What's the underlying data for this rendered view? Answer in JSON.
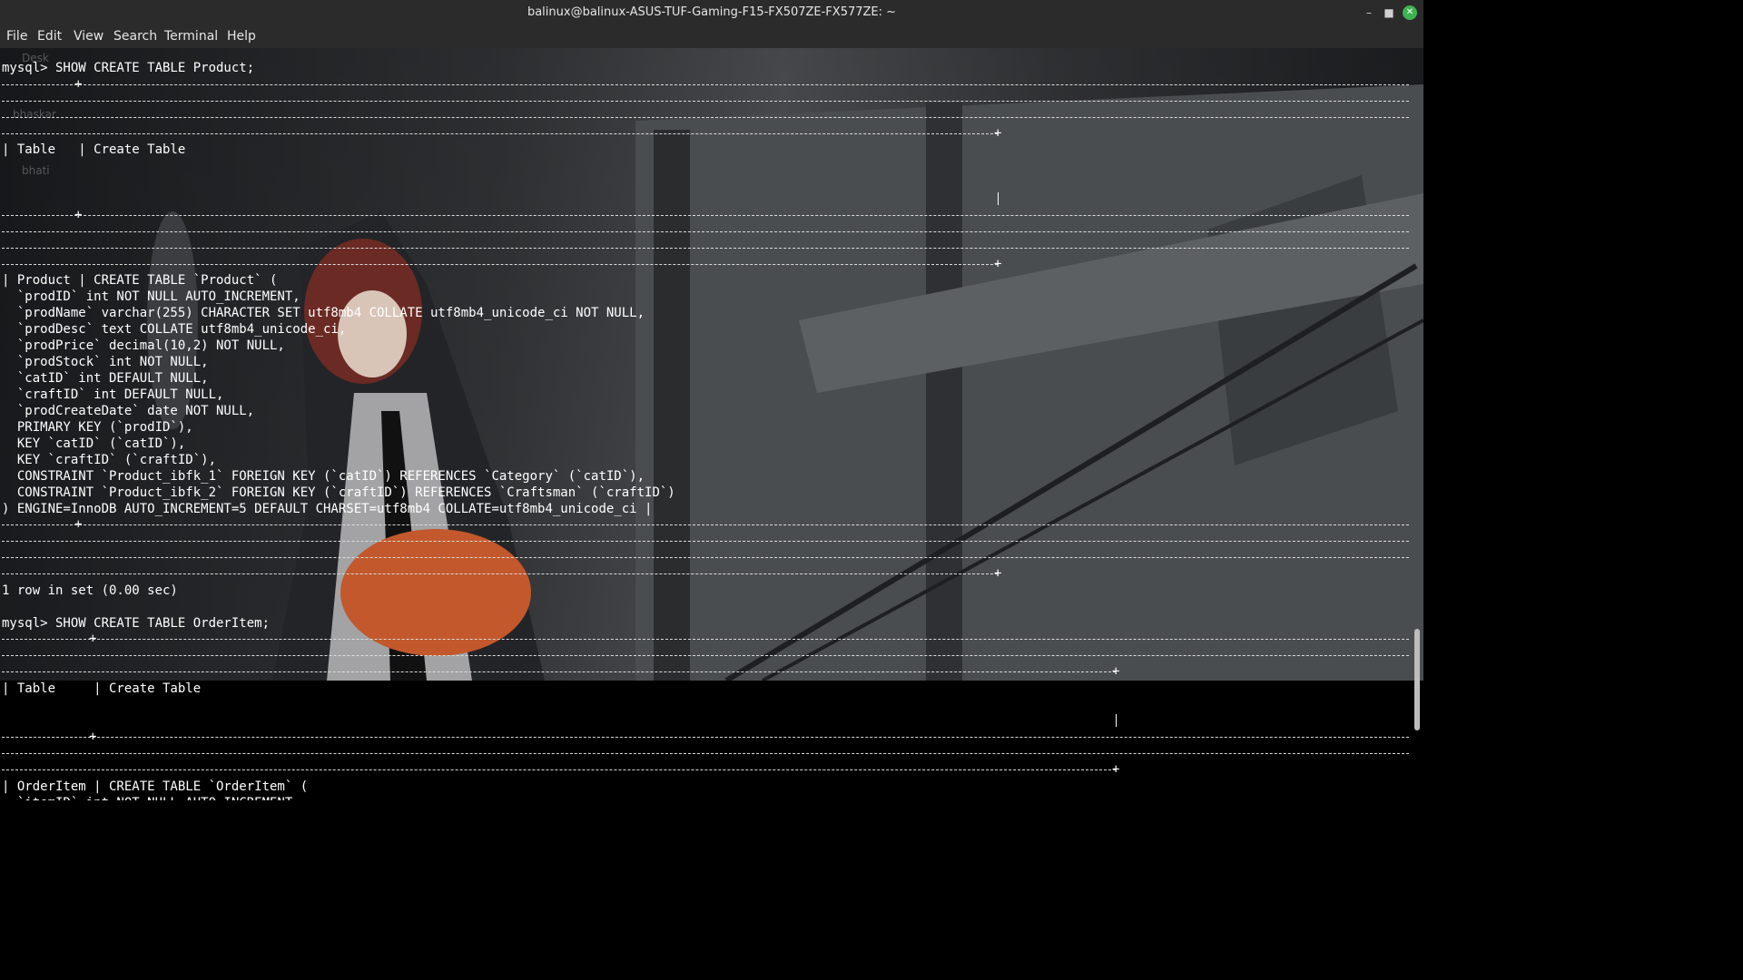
{
  "window": {
    "title": "balinux@balinux-ASUS-TUF-Gaming-F15-FX507ZE-FX577ZE: ~",
    "minimize_icon": "minimize-icon",
    "maximize_icon": "maximize-icon",
    "close_icon": "close-icon"
  },
  "menu": [
    "File",
    "Edit",
    "View",
    "Search",
    "Terminal",
    "Help"
  ],
  "desktop_labels": [
    "Desk",
    "bhaskar",
    "bhati"
  ],
  "terminal": {
    "lines": [
      "mysql> SHOW CREATE TABLE Product;",
      "",
      "",
      "",
      "",
      "| Table   | Create Table",
      "",
      "",
      "",
      "",
      "",
      "",
      "",
      "| Product | CREATE TABLE `Product` (",
      "  `prodID` int NOT NULL AUTO_INCREMENT,",
      "  `prodName` varchar(255) CHARACTER SET utf8mb4 COLLATE utf8mb4_unicode_ci NOT NULL,",
      "  `prodDesc` text COLLATE utf8mb4_unicode_ci,",
      "  `prodPrice` decimal(10,2) NOT NULL,",
      "  `prodStock` int NOT NULL,",
      "  `catID` int DEFAULT NULL,",
      "  `craftID` int DEFAULT NULL,",
      "  `prodCreateDate` date NOT NULL,",
      "  PRIMARY KEY (`prodID`),",
      "  KEY `catID` (`catID`),",
      "  KEY `craftID` (`craftID`),",
      "  CONSTRAINT `Product_ibfk_1` FOREIGN KEY (`catID`) REFERENCES `Category` (`catID`),",
      "  CONSTRAINT `Product_ibfk_2` FOREIGN KEY (`craftID`) REFERENCES `Craftsman` (`craftID`)",
      ") ENGINE=InnoDB AUTO_INCREMENT=5 DEFAULT CHARSET=utf8mb4 COLLATE=utf8mb4_unicode_ci |",
      "",
      "",
      "",
      "",
      "1 row in set (0.00 sec)",
      "",
      "mysql> SHOW CREATE TABLE OrderItem;",
      "",
      "",
      "",
      "| Table     | Create Table",
      "",
      "",
      "",
      "",
      "",
      "| OrderItem | CREATE TABLE `OrderItem` (",
      "  `itemID` int NOT NULL AUTO_INCREMENT,"
    ]
  }
}
